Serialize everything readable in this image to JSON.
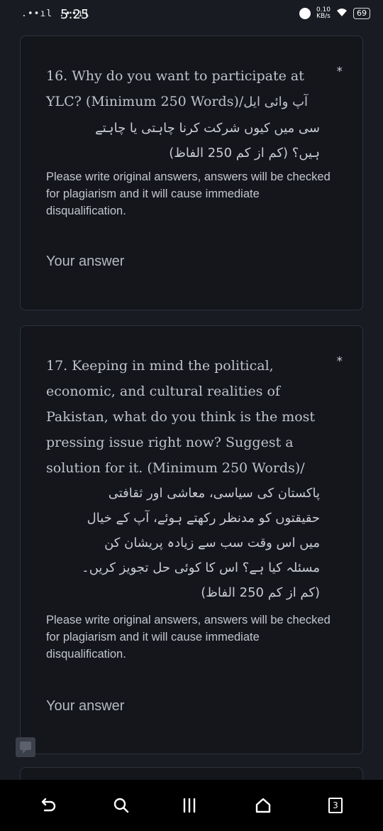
{
  "status": {
    "signal": ".••ıl .••ıl",
    "time": "5:25",
    "net_speed": "0.10",
    "net_unit": "KB/s",
    "battery": "69"
  },
  "questions": [
    {
      "title_line1": "16. Why do you want to participate at",
      "title_line2_en": "YLC? (Minimum 250 Words)/",
      "urdu_inline": "آپ وائی ایل",
      "urdu_lines": [
        "سی میں کیوں شرکت کرنا چاہتی یا چاہتے",
        "ہیں؟ (کم از کم 250 الفاظ)"
      ],
      "required_mark": "*",
      "help": "Please write original answers, answers will be checked for plagiarism and it will cause immediate disqualification.",
      "answer_placeholder": "Your answer"
    },
    {
      "title_lines": [
        "17. Keeping in mind the political,",
        "economic, and cultural realities of",
        "Pakistan, what do you think is the most",
        "pressing issue right now? Suggest a",
        "solution for it. (Minimum 250 Words)/"
      ],
      "urdu_lines": [
        "پاکستان کی سیاسی، معاشی اور ثقافتی",
        "حقیقتوں کو مدنظر رکھتے ہوئے، آپ کے خیال",
        "میں اس وقت سب سے زیادہ پریشان کن",
        "مسئلہ کیا ہے؟ اس کا کوئی حل تجویز کریں۔",
        "(کم از کم 250 الفاظ)"
      ],
      "required_mark": "*",
      "help": "Please write original answers, answers will be checked for plagiarism and it will cause immediate disqualification.",
      "answer_placeholder": "Your answer"
    }
  ],
  "navbar": {
    "icons": [
      "back-icon",
      "search-icon",
      "menu-icon",
      "home-icon",
      "tabs-icon"
    ],
    "tabs_count": "3"
  }
}
